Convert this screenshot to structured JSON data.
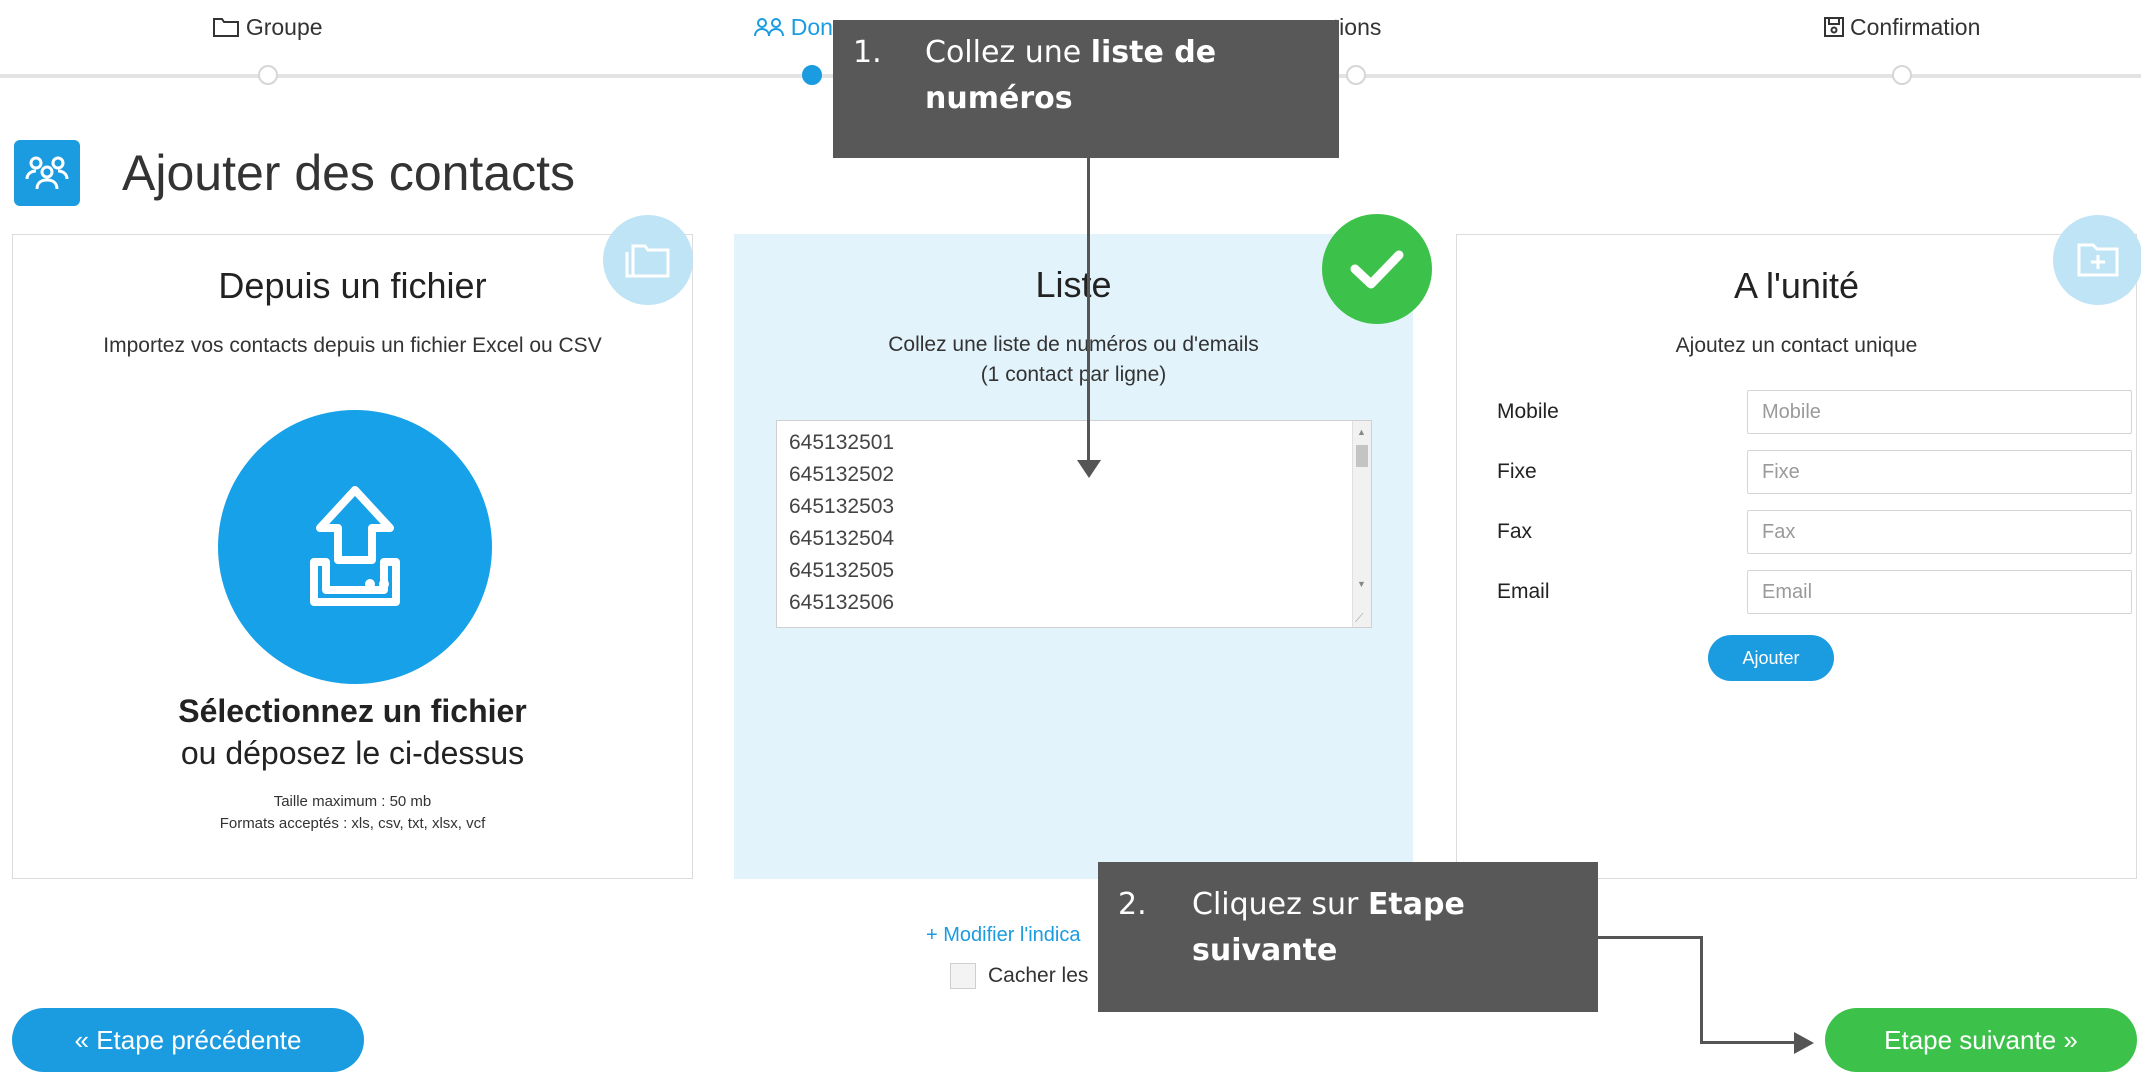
{
  "stepper": {
    "steps": [
      {
        "label": "Groupe",
        "icon": "folder-icon",
        "active": false
      },
      {
        "label": "Donn",
        "icon": "contacts-icon",
        "active": true
      },
      {
        "label": "Options",
        "icon": "options-icon",
        "active": false
      },
      {
        "label": "Confirmation",
        "icon": "save-icon",
        "active": false
      }
    ],
    "options_visible_label": "ptions"
  },
  "header": {
    "title": "Ajouter des contacts",
    "icon": "contacts-icon"
  },
  "file_panel": {
    "title": "Depuis un fichier",
    "subtitle": "Importez vos contacts depuis un fichier Excel ou CSV",
    "select_text": "Sélectionnez un fichier",
    "drop_text": "ou déposez le ci-dessus",
    "max_size": "Taille maximum : 50 mb",
    "formats": "Formats acceptés : xls, csv, txt, xlsx, vcf",
    "badge_icon": "folder-icon"
  },
  "list_panel": {
    "title": "Liste",
    "subtitle_line1": "Collez une liste de numéros ou d'emails",
    "subtitle_line2": "(1 contact par ligne)",
    "numbers": [
      "645132501",
      "645132502",
      "645132503",
      "645132504",
      "645132505",
      "645132506"
    ],
    "badge_icon": "checkmark-icon"
  },
  "unit_panel": {
    "title": "A l'unité",
    "subtitle": "Ajoutez un contact unique",
    "fields": [
      {
        "label": "Mobile",
        "placeholder": "Mobile"
      },
      {
        "label": "Fixe",
        "placeholder": "Fixe"
      },
      {
        "label": "Fax",
        "placeholder": "Fax"
      },
      {
        "label": "Email",
        "placeholder": "Email"
      }
    ],
    "add_button": "Ajouter",
    "badge_icon": "folder-plus-icon"
  },
  "bottom": {
    "modify_link": "+ Modifier l'indica",
    "hide_label": "Cacher les",
    "prev_button": "« Etape précédente",
    "next_button": "Etape suivante »"
  },
  "annotations": {
    "callout1": {
      "number": "1.",
      "text": "Collez une ",
      "bold": "liste de numéros"
    },
    "callout2": {
      "number": "2.",
      "text": "Cliquez sur ",
      "bold": "Etape suivante"
    }
  },
  "colors": {
    "accent": "#1b9be0",
    "success": "#3cc24a",
    "list_bg": "#e2f3fb",
    "callout": "#585858"
  }
}
